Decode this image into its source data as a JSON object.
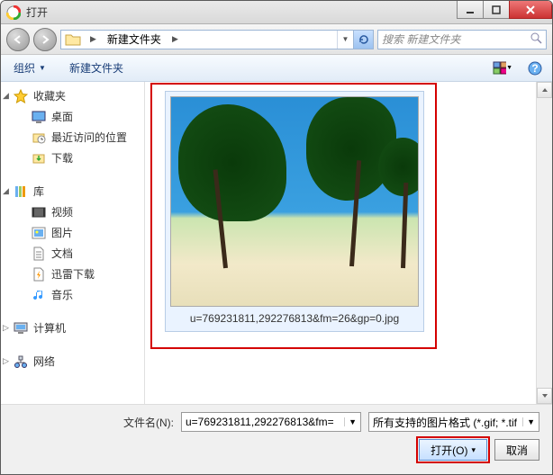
{
  "window": {
    "title": "打开"
  },
  "nav": {
    "path_segment": "新建文件夹",
    "path_sep": "▶",
    "search_placeholder": "搜索 新建文件夹"
  },
  "toolbar": {
    "organize": "组织",
    "new_folder": "新建文件夹"
  },
  "sidebar": {
    "favorites": {
      "label": "收藏夹",
      "items": [
        "桌面",
        "最近访问的位置",
        "下载"
      ]
    },
    "libraries": {
      "label": "库",
      "items": [
        "视频",
        "图片",
        "文档",
        "迅雷下载",
        "音乐"
      ]
    },
    "computer": {
      "label": "计算机"
    },
    "network": {
      "label": "网络"
    }
  },
  "content": {
    "file_label": "u=769231811,292276813&fm=26&gp=0.jpg"
  },
  "footer": {
    "filename_label": "文件名(N):",
    "filename_value": "u=769231811,292276813&fm=",
    "filetype_value": "所有支持的图片格式 (*.gif; *.tif",
    "open_btn": "打开(O)",
    "cancel_btn": "取消"
  },
  "glyphs": {
    "chev": "▸",
    "tri_down": "▼",
    "tri_split": "▾"
  }
}
